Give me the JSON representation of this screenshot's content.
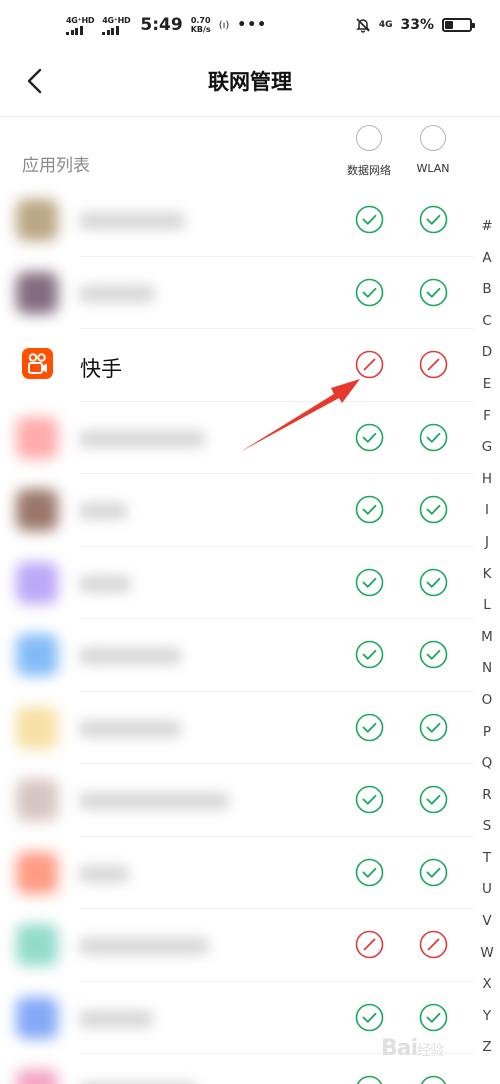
{
  "status_bar": {
    "signal1": "4G⁺HD",
    "signal2": "4G⁺HD",
    "time": "5:49",
    "speed_value": "0.70",
    "speed_unit": "KB/s",
    "hotspot": "(ı)",
    "more": "•••",
    "network": "4G",
    "battery_percent": "33%",
    "battery_level": 0.33
  },
  "header": {
    "title": "联网管理"
  },
  "list": {
    "title": "应用列表",
    "col_data": "数据网络",
    "col_wlan": "WLAN"
  },
  "colors": {
    "allowed": "#1aa85c",
    "blocked": "#e03b3b",
    "arrow": "#e8382c",
    "kuaishou": "#ff5000"
  },
  "apps": [
    {
      "name": "",
      "blurred": true,
      "icon_color": "#a58a5b",
      "data": "allowed",
      "wlan": "allowed",
      "blur_width": 108
    },
    {
      "name": "",
      "blurred": true,
      "icon_color": "#5a3b55",
      "data": "allowed",
      "wlan": "allowed",
      "blur_width": 78
    },
    {
      "name": "快手",
      "blurred": false,
      "icon": "kuaishou-logo",
      "data": "blocked",
      "wlan": "blocked"
    },
    {
      "name": "",
      "blurred": true,
      "icon_color": "#ff8f8f",
      "data": "allowed",
      "wlan": "allowed",
      "blur_width": 128
    },
    {
      "name": "",
      "blurred": true,
      "icon_color": "#7a4a3a",
      "data": "allowed",
      "wlan": "allowed",
      "blur_width": 50
    },
    {
      "name": "",
      "blurred": true,
      "icon_color": "#a58cf5",
      "data": "allowed",
      "wlan": "allowed",
      "blur_width": 54
    },
    {
      "name": "",
      "blurred": true,
      "icon_color": "#5aa5f5",
      "data": "allowed",
      "wlan": "allowed",
      "blur_width": 104
    },
    {
      "name": "",
      "blurred": true,
      "icon_color": "#f5d587",
      "data": "allowed",
      "wlan": "allowed",
      "blur_width": 104
    },
    {
      "name": "",
      "blurred": true,
      "icon_color": "#c9b3ae",
      "data": "allowed",
      "wlan": "allowed",
      "blur_width": 152
    },
    {
      "name": "",
      "blurred": true,
      "icon_color": "#ff7a5c",
      "data": "allowed",
      "wlan": "allowed",
      "blur_width": 52
    },
    {
      "name": "",
      "blurred": true,
      "icon_color": "#6fd0b8",
      "data": "blocked",
      "wlan": "blocked",
      "blur_width": 132
    },
    {
      "name": "",
      "blurred": true,
      "icon_color": "#5b8df5",
      "data": "allowed",
      "wlan": "allowed",
      "blur_width": 76
    },
    {
      "name": "",
      "blurred": true,
      "icon_color": "#f08ab0",
      "data": "allowed",
      "wlan": "allowed",
      "blur_width": 120
    }
  ],
  "alphabet": [
    "#",
    "A",
    "B",
    "C",
    "D",
    "E",
    "F",
    "G",
    "H",
    "I",
    "J",
    "K",
    "L",
    "M",
    "N",
    "O",
    "P",
    "Q",
    "R",
    "S",
    "T",
    "U",
    "V",
    "W",
    "X",
    "Y",
    "Z"
  ],
  "watermark": {
    "brand": "Bai",
    "suffix": "经验"
  }
}
